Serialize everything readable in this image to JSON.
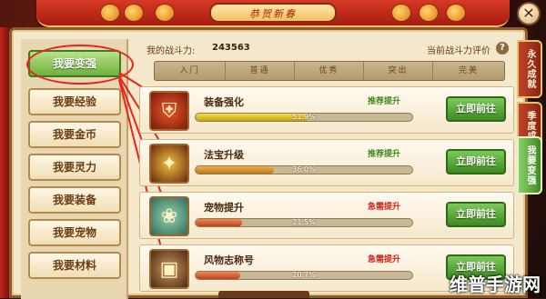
{
  "header": {
    "title": "恭贺新春",
    "close_label": "✕"
  },
  "sidebar": {
    "items": [
      {
        "label": "我要变强",
        "active": true
      },
      {
        "label": "我要经验",
        "active": false
      },
      {
        "label": "我要金币",
        "active": false
      },
      {
        "label": "我要灵力",
        "active": false
      },
      {
        "label": "我要装备",
        "active": false
      },
      {
        "label": "我要宠物",
        "active": false
      },
      {
        "label": "我要材料",
        "active": false
      }
    ]
  },
  "power": {
    "label": "我的战斗力:",
    "value": "243563",
    "eval_label": "当前战斗力评价",
    "help": "?"
  },
  "rating": {
    "segments": [
      "入门",
      "普通",
      "优秀",
      "突出",
      "完美"
    ]
  },
  "tasks": [
    {
      "name": "装备强化",
      "tag": "推荐提升",
      "tag_type": "recommend",
      "progress": 51.9,
      "progress_label": "51.9%",
      "button": "立即前往",
      "icon": "armor-icon"
    },
    {
      "name": "法宝升级",
      "tag": "推荐提升",
      "tag_type": "recommend",
      "progress": 36.0,
      "progress_label": "36.0%",
      "button": "立即前往",
      "icon": "treasure-icon"
    },
    {
      "name": "宠物提升",
      "tag": "急需提升",
      "tag_type": "urgent",
      "progress": 21.5,
      "progress_label": "21.5%",
      "button": "立即前往",
      "icon": "pet-icon"
    },
    {
      "name": "风物志称号",
      "tag": "急需提升",
      "tag_type": "urgent",
      "progress": 20.7,
      "progress_label": "20.7%",
      "button": "立即前往",
      "icon": "badge-icon"
    }
  ],
  "right_tabs": [
    {
      "label": "永久成就",
      "active": false
    },
    {
      "label": "季度成就",
      "active": false
    },
    {
      "label": "我要变强",
      "active": true
    }
  ],
  "watermark": "维普手游网",
  "colors": {
    "accent_green": "#3f8a22",
    "recommend": "#3f8a1c",
    "urgent": "#d2261a",
    "frame": "#8d5a2b"
  }
}
